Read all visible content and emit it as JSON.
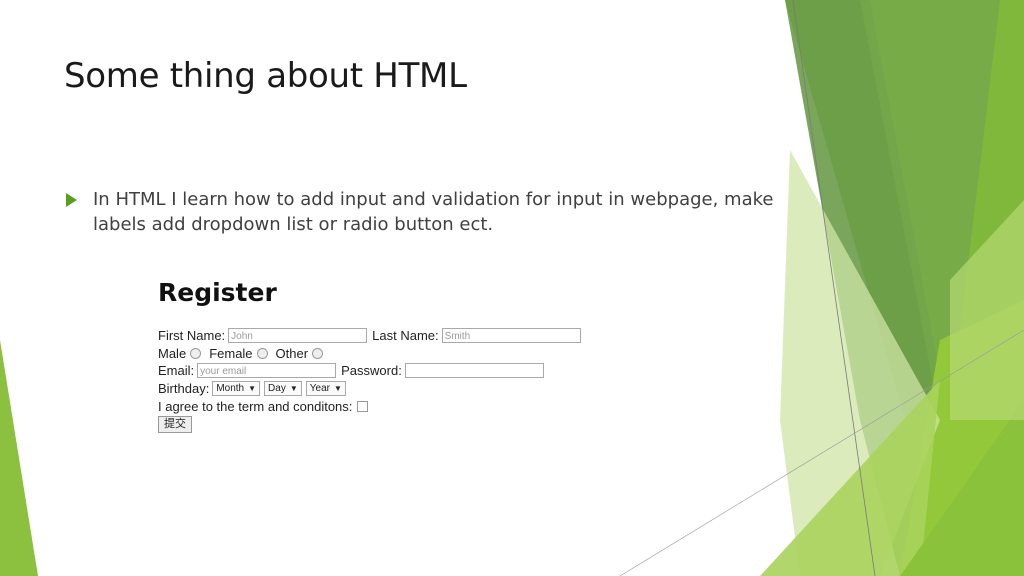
{
  "slide": {
    "title": "Some thing about HTML",
    "bullet_text": "In HTML I learn how to add input and validation for input in webpage, make labels add dropdown list or radio button ect."
  },
  "form": {
    "heading": "Register",
    "first_name_label": "First Name:",
    "first_name_placeholder": "John",
    "last_name_label": "Last Name:",
    "last_name_placeholder": "Smith",
    "gender_options": [
      "Male",
      "Female",
      "Other"
    ],
    "email_label": "Email:",
    "email_placeholder": "your email",
    "password_label": "Password:",
    "birthday_label": "Birthday:",
    "month_value": "Month",
    "day_value": "Day",
    "year_value": "Year",
    "agree_label": "I agree to the term and conditons:",
    "submit_label": "提交"
  },
  "colors": {
    "accent": "#5a9e1e",
    "green_dark": "#4e8a2c",
    "green_light": "#8fc63d"
  }
}
